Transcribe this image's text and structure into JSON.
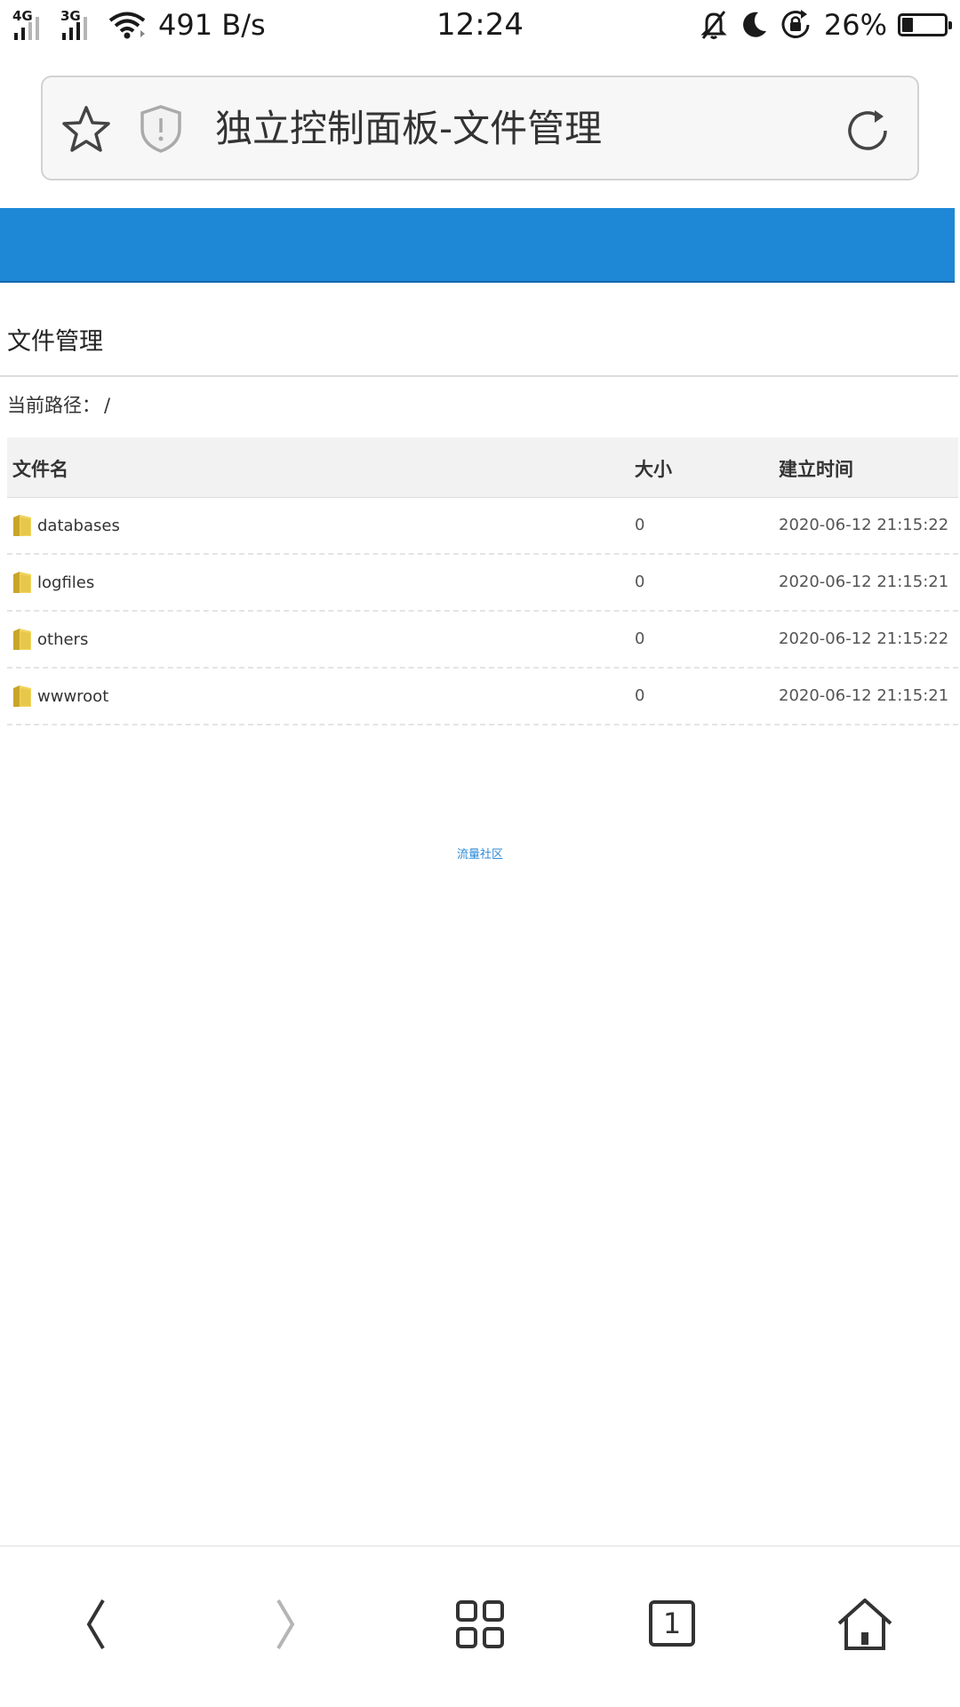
{
  "status_bar": {
    "signal_1": "4G",
    "signal_2": "3G",
    "net_speed": "491 B/s",
    "time": "12:24",
    "battery_pct": "26%",
    "battery_level": 0.26,
    "icons": [
      "wifi-icon",
      "mute-icon",
      "moon-icon",
      "rotation-lock-icon",
      "battery-icon"
    ]
  },
  "browser": {
    "page_title": "独立控制面板-文件管理",
    "icons": [
      "star-icon",
      "shield-icon",
      "reload-icon"
    ]
  },
  "page": {
    "heading": "文件管理",
    "path_label": "当前路径：",
    "path_value": "/",
    "footer_link": "流量社区"
  },
  "table": {
    "headers": {
      "name": "文件名",
      "size": "大小",
      "time": "建立时间"
    },
    "rows": [
      {
        "name": "databases",
        "size": "0",
        "time": "2020-06-12 21:15:22"
      },
      {
        "name": "logfiles",
        "size": "0",
        "time": "2020-06-12 21:15:21"
      },
      {
        "name": "others",
        "size": "0",
        "time": "2020-06-12 21:15:22"
      },
      {
        "name": "wwwroot",
        "size": "0",
        "time": "2020-06-12 21:15:21"
      }
    ]
  },
  "bottom_nav": {
    "tab_count": "1",
    "icons": [
      "back-icon",
      "forward-icon",
      "menu-grid-icon",
      "tabs-icon",
      "home-icon"
    ]
  },
  "colors": {
    "header_blue": "#1e88d6",
    "link_blue": "#2a8ad8",
    "folder_yellow": "#e8c84a"
  }
}
